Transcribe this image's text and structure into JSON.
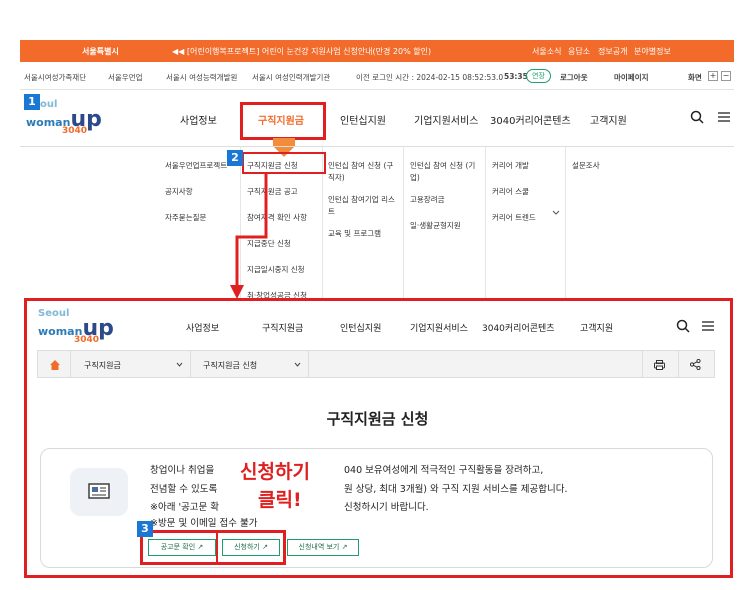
{
  "topbar": {
    "brand": "서울특별시",
    "notice": "◀◀ [어린이행복프로젝트] 어린이 눈건강 지원사업 신청안내(만경 20% 할인)",
    "links": [
      "서울소식",
      "응답소",
      "정보공개",
      "분야별정보"
    ]
  },
  "utilbar": {
    "sites": [
      "서울시여성가족재단",
      "서울우먼업",
      "서울시 여성능력개발원",
      "서울시 여성인력개발기관"
    ],
    "last_login": "이전 로그인 시간 : 2024-02-15 08:52:53.0",
    "timer": "53:35",
    "extend": "연장",
    "logout": "로그아웃",
    "mypage": "마이페이지",
    "screen": "화면",
    "plus": "+",
    "minus": "−"
  },
  "logo": {
    "seoul": "Seoul",
    "woman": "woman",
    "up": "up",
    "n3040": "3040"
  },
  "nav": [
    "사업정보",
    "구직지원금",
    "인턴십지원",
    "기업지원서비스",
    "3040커리어콘텐츠",
    "고객지원"
  ],
  "submenu": {
    "col1": [
      "서울우먼업프로젝트",
      "공지사항",
      "자주묻는질문"
    ],
    "col2": [
      "구직지원금 신청",
      "구직지원금 공고",
      "참여자격 확인 사항",
      "지급중단 신청",
      "지급일시중지 신청",
      "취·창업성공금 신청"
    ],
    "col3": [
      "인턴십 참여 신청 (구직자)",
      "인턴십 참여기업 리스트",
      "교육 및 프로그램"
    ],
    "col4": [
      "인턴십 참여 신청 (기업)",
      "고용장려금",
      "일·생활균형지원"
    ],
    "col5": [
      "커리어 개발",
      "커리어 스쿨",
      "커리어 트렌드"
    ],
    "col6": [
      "설문조사"
    ]
  },
  "badges": [
    "1",
    "2",
    "3"
  ],
  "crumb": {
    "level1": "구직지원금",
    "level2": "구직지원금 신청"
  },
  "page_title": "구직지원금 신청",
  "description": {
    "line1_a": "창업이나 취업을",
    "line1_b": "040 보유여성에게 적극적인 구직활동을 장려하고,",
    "line2_a": "전념할 수 있도록",
    "line2_b": "원 상당, 최대 3개월) 와 구직 지원 서비스를 제공합니다.",
    "line3_a": "※아래 '공고문 확",
    "line3_b": "신청하시기 바랍니다.",
    "line4": "※방문 및 이메일 접수 불가"
  },
  "annotation": {
    "line1": "신청하기",
    "line2": "클릭!"
  },
  "buttons": {
    "notice": "공고문 확인",
    "apply": "신청하기",
    "history": "신청내역 보기"
  }
}
